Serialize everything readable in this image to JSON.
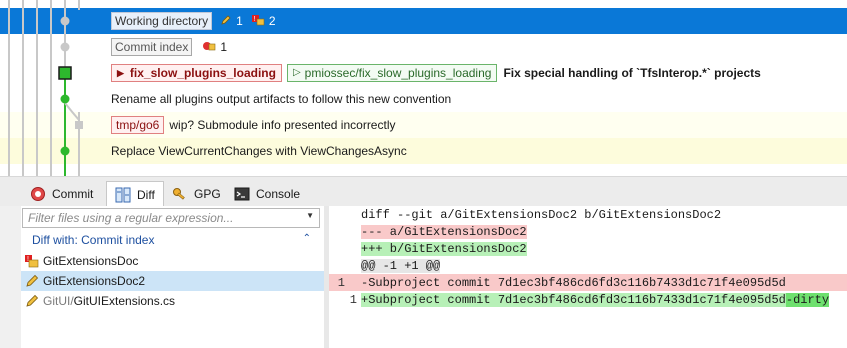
{
  "grid": {
    "working_directory": {
      "label": "Working directory",
      "unstaged_count": "1",
      "untracked_count": "2"
    },
    "commit_index": {
      "label": "Commit index",
      "count": "1"
    },
    "commit_head": {
      "local_branch": "fix_slow_plugins_loading",
      "remote_branch": "pmiossec/fix_slow_plugins_loading",
      "message": "Fix special handling of `TfsInterop.*` projects"
    },
    "commit_rename": {
      "message": "Rename all plugins output artifacts to follow this new convention"
    },
    "commit_wip": {
      "branch": "tmp/go6",
      "message": "wip? Submodule info presented incorrectly"
    },
    "commit_replace": {
      "message": "Replace ViewCurrentChanges with ViewChangesAsync"
    }
  },
  "tabs": [
    {
      "label": "Commit",
      "icon": "commit-icon"
    },
    {
      "label": "Diff",
      "icon": "diff-icon"
    },
    {
      "label": "GPG",
      "icon": "key-icon"
    },
    {
      "label": "Console",
      "icon": "console-icon"
    }
  ],
  "filelist": {
    "filter_placeholder": "Filter files using a regular expression...",
    "diff_with_label": "Diff with: Commit index",
    "files": [
      {
        "dir": "",
        "name": "GitExtensionsDoc",
        "icon": "submodule-warning-icon"
      },
      {
        "dir": "",
        "name": "GitExtensionsDoc2",
        "icon": "pencil-icon"
      },
      {
        "dir": "GitUI/",
        "name": "GitUIExtensions.cs",
        "icon": "pencil-icon"
      }
    ]
  },
  "diff": {
    "header1": "diff --git a/GitExtensionsDoc2 b/GitExtensionsDoc2",
    "header2": "--- a/GitExtensionsDoc2",
    "header3": "+++ b/GitExtensionsDoc2",
    "hunk": "@@ -1 +1 @@",
    "removed_line_no": "1",
    "removed": "-Subproject commit 7d1ec3bf486cd6fd3c116b7433d1c71f4e095d5d",
    "added_line_no": "1",
    "added_prefix": "+Subproject commit 7d1ec3bf486cd6fd3c116b7433d1c71f4e095d5d",
    "added_suffix": "-dirty"
  },
  "colors": {
    "selection": "#0a78d7",
    "graph_green": "#2db82d",
    "graph_gray": "#c8c8c8",
    "removed_bg": "#f9c9c9",
    "added_bg": "#b7f0b7"
  }
}
